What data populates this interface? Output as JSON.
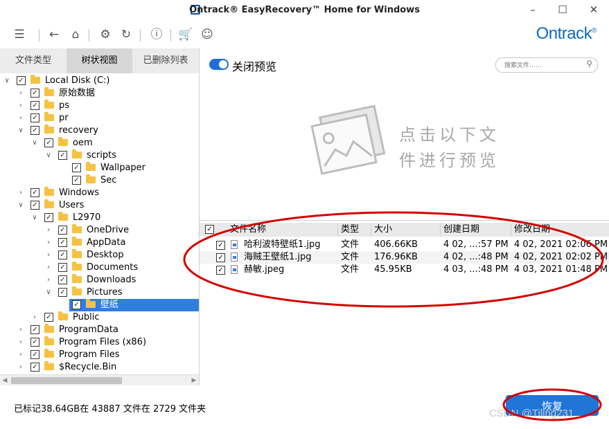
{
  "window": {
    "title": "Ontrack® EasyRecovery™ Home for Windows",
    "minimize_icon": "minimize-icon",
    "maximize_icon": "maximize-icon",
    "close_icon": "close-icon"
  },
  "toolbar": {
    "icons": [
      "menu-icon",
      "back-icon",
      "home-icon",
      "gear-icon",
      "history-icon",
      "info-icon",
      "cart-icon",
      "account-icon"
    ],
    "brand": "Ontrack"
  },
  "left_panel": {
    "tabs": [
      {
        "label": "文件类型",
        "active": false
      },
      {
        "label": "树状视图",
        "active": true
      },
      {
        "label": "已删除列表",
        "active": false
      }
    ],
    "tree": [
      {
        "label": "Local Disk (C:)",
        "level": 0,
        "expanded": true,
        "checked": true
      },
      {
        "label": "原始数据",
        "level": 1,
        "expanded": false,
        "checked": true
      },
      {
        "label": "ps",
        "level": 1,
        "expanded": false,
        "checked": true
      },
      {
        "label": "pr",
        "level": 1,
        "expanded": false,
        "checked": true
      },
      {
        "label": "recovery",
        "level": 1,
        "expanded": true,
        "checked": true
      },
      {
        "label": "oem",
        "level": 2,
        "expanded": true,
        "checked": true
      },
      {
        "label": "scripts",
        "level": 3,
        "expanded": true,
        "checked": true
      },
      {
        "label": "Wallpaper",
        "level": 4,
        "expanded": null,
        "checked": true
      },
      {
        "label": "Sec",
        "level": 4,
        "expanded": null,
        "checked": true
      },
      {
        "label": "Windows",
        "level": 1,
        "expanded": false,
        "checked": true
      },
      {
        "label": "Users",
        "level": 1,
        "expanded": true,
        "checked": true
      },
      {
        "label": "L2970",
        "level": 2,
        "expanded": true,
        "checked": true
      },
      {
        "label": "OneDrive",
        "level": 3,
        "expanded": false,
        "checked": true
      },
      {
        "label": "AppData",
        "level": 3,
        "expanded": false,
        "checked": true
      },
      {
        "label": "Desktop",
        "level": 3,
        "expanded": false,
        "checked": true
      },
      {
        "label": "Documents",
        "level": 3,
        "expanded": false,
        "checked": true
      },
      {
        "label": "Downloads",
        "level": 3,
        "expanded": false,
        "checked": true
      },
      {
        "label": "Pictures",
        "level": 3,
        "expanded": true,
        "checked": true
      },
      {
        "label": "壁纸",
        "level": 4,
        "expanded": null,
        "checked": true,
        "selected": true
      },
      {
        "label": "Public",
        "level": 2,
        "expanded": false,
        "checked": true
      },
      {
        "label": "ProgramData",
        "level": 1,
        "expanded": false,
        "checked": true
      },
      {
        "label": "Program Files (x86)",
        "level": 1,
        "expanded": false,
        "checked": true
      },
      {
        "label": "Program Files",
        "level": 1,
        "expanded": false,
        "checked": true
      },
      {
        "label": "$Recycle.Bin",
        "level": 1,
        "expanded": false,
        "checked": true
      }
    ]
  },
  "preview": {
    "toggle_label": "关闭预览",
    "toggle_on": true,
    "search_placeholder": "搜索文件……",
    "placeholder_line1": "点击以下文",
    "placeholder_line2": "件进行预览"
  },
  "file_table": {
    "columns": [
      "文件名称",
      "类型",
      "大小",
      "创建日期",
      "修改日期"
    ],
    "rows": [
      {
        "name": "哈利波特壁纸1.jpg",
        "type": "文件",
        "size": "406.66KB",
        "created": "4 02, ...:57 PM",
        "modified": "4 02, 2021 02:06 PM"
      },
      {
        "name": "海贼王壁纸1.jpg",
        "type": "文件",
        "size": "176.96KB",
        "created": "4 02, ...:48 PM",
        "modified": "4 02, 2021 02:02 PM"
      },
      {
        "name": "赫敏.jpeg",
        "type": "文件",
        "size": "45.95KB",
        "created": "4 03, ...:48 PM",
        "modified": "4 03, 2021 01:48 PM"
      }
    ]
  },
  "status": {
    "text": "已标记38.64GB在 43887 文件在 2729 文件夹",
    "recover_label": "恢复",
    "watermark": "CSDN @Tiling231"
  },
  "colors": {
    "accent": "#1f75d8",
    "brand": "#0b6bbd",
    "selection": "#2f7fe0",
    "folder": "#f5c242",
    "annotation": "#d40000"
  }
}
